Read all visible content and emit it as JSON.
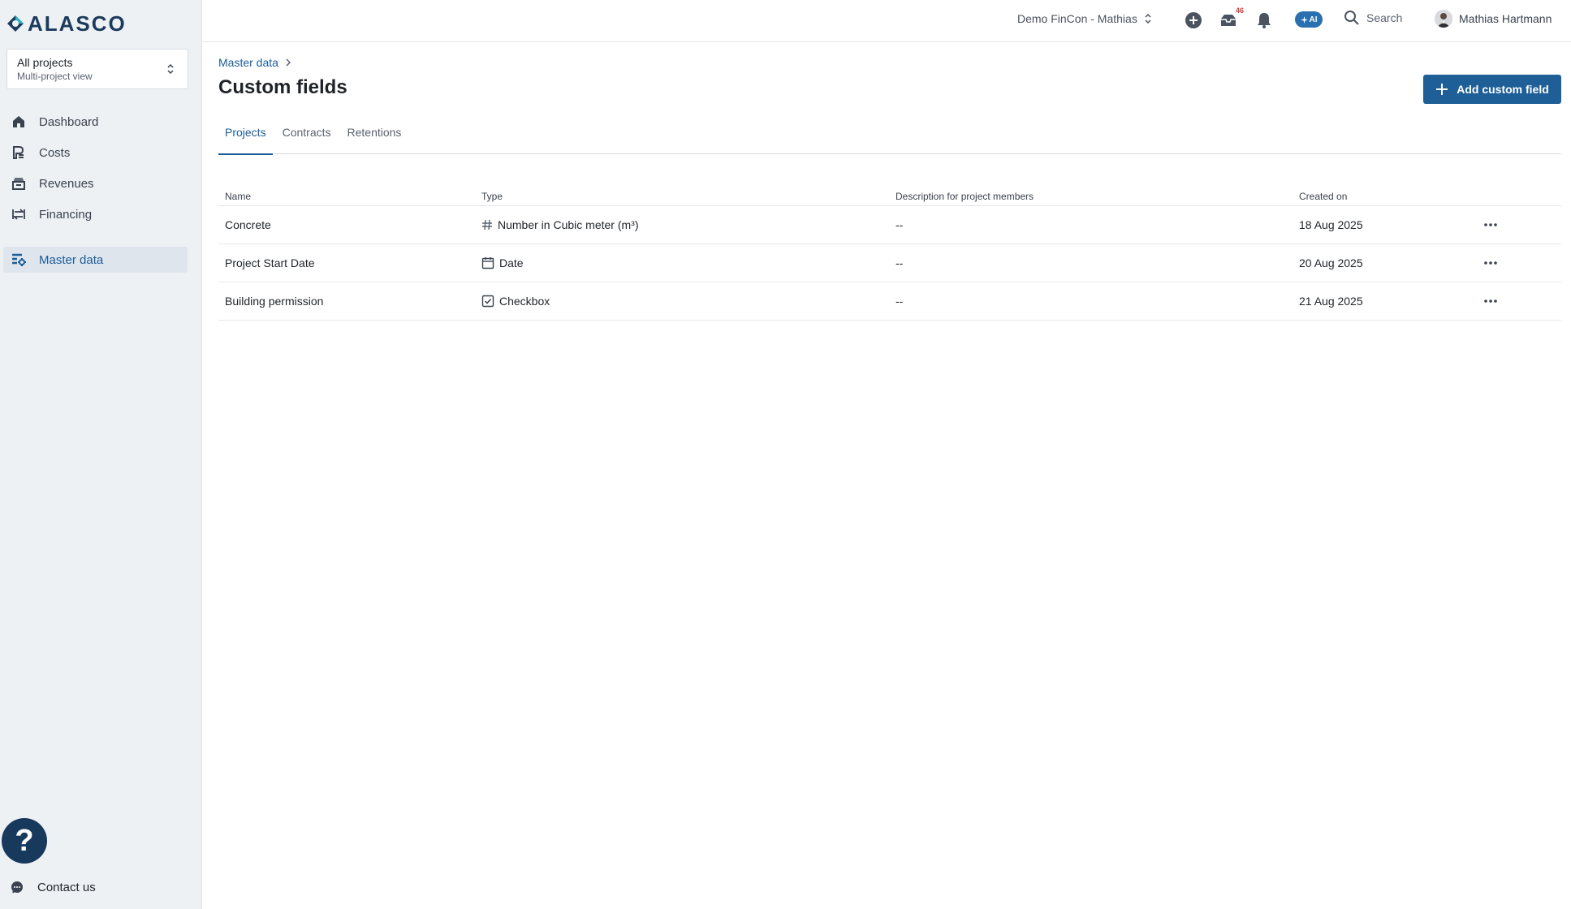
{
  "app": {
    "logo_text": "ALASCO"
  },
  "project_selector": {
    "title": "All projects",
    "subtitle": "Multi-project view"
  },
  "sidebar": {
    "items": [
      {
        "label": "Dashboard"
      },
      {
        "label": "Costs"
      },
      {
        "label": "Revenues"
      },
      {
        "label": "Financing"
      },
      {
        "label": "Master data"
      }
    ],
    "contact_label": "Contact us",
    "help_label": "?"
  },
  "topbar": {
    "company": "Demo FinCon - Mathias",
    "inbox_badge": "46",
    "ai_label": "AI",
    "search_label": "Search",
    "user_name": "Mathias Hartmann"
  },
  "page": {
    "breadcrumb": "Master data",
    "title": "Custom fields",
    "add_button": "Add custom field",
    "tabs": [
      {
        "label": "Projects"
      },
      {
        "label": "Contracts"
      },
      {
        "label": "Retentions"
      }
    ]
  },
  "table": {
    "headers": {
      "name": "Name",
      "type": "Type",
      "description": "Description for project members",
      "created": "Created on"
    },
    "rows": [
      {
        "name": "Concrete",
        "type": "Number in Cubic meter (m³)",
        "description": "--",
        "created": "18 Aug 2025"
      },
      {
        "name": "Project Start Date",
        "type": "Date",
        "description": "--",
        "created": "20 Aug 2025"
      },
      {
        "name": "Building permission",
        "type": "Checkbox",
        "description": "--",
        "created": "21 Aug 2025"
      }
    ]
  },
  "colors": {
    "primary": "#1e5f97",
    "link": "#1c5d99",
    "sidebar_bg": "#eef1f4",
    "help_bg": "#17395c"
  }
}
